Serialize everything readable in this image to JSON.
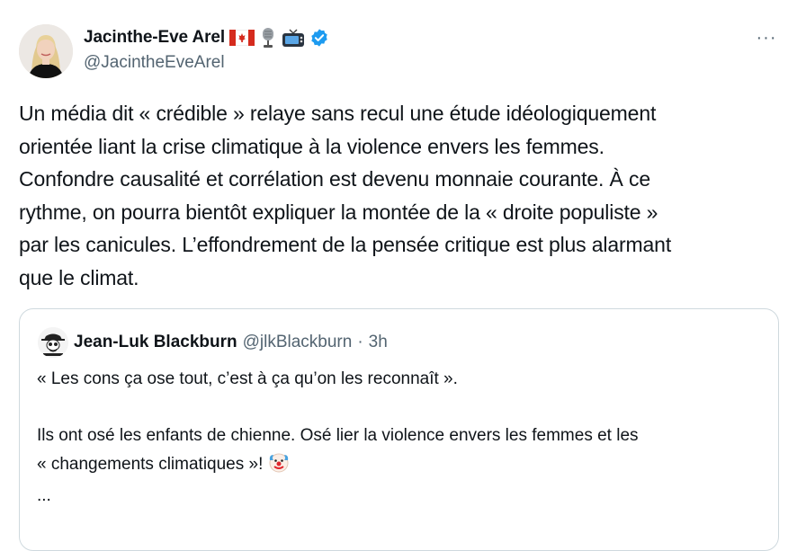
{
  "author": {
    "display_name": "Jacinthe-Eve Arel",
    "handle": "@JacintheEveArel",
    "badges": [
      "canada-flag-icon",
      "microphone-icon",
      "television-icon",
      "verified-badge-icon"
    ],
    "verified_color": "#1d9bf0"
  },
  "more_label": "···",
  "tweet": {
    "text": "Un média dit « crédible » relaye sans recul une étude idéologiquement\norientée liant la crise climatique à la violence envers les femmes.\nConfondre causalité et corrélation est devenu monnaie courante. À ce\nrythme, on pourra bientôt expliquer la montée de la « droite populiste »\npar les canicules. L’effondrement de la pensée critique est plus alarmant\nque le climat."
  },
  "quoted": {
    "display_name": "Jean-Luk Blackburn",
    "handle": "@jlkBlackburn",
    "separator": "·",
    "time": "3h",
    "text_line1": "« Les cons ça ose tout, c’est à ça qu’on les reconnaît ».",
    "text_line2": "Ils ont osé les enfants de chienne. Osé lier la violence envers les femmes et les\n« changements climatiques »!",
    "text_emoji": "clown-face-icon",
    "ellipsis": "..."
  },
  "colors": {
    "text": "#0f1419",
    "secondary": "#536471",
    "border": "#cfd9de"
  }
}
